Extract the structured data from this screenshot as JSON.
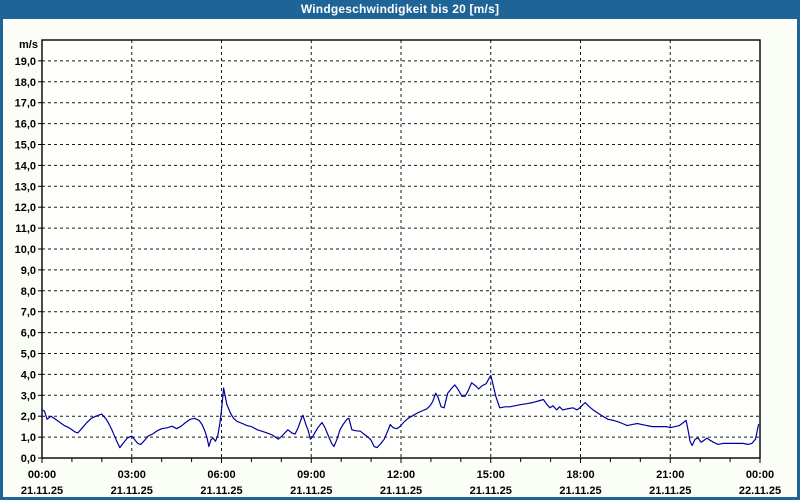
{
  "window": {
    "title": "Windgeschwindigkeit bis 20 [m/s]"
  },
  "colors": {
    "titlebar_bg": "#1e6496",
    "titlebar_text": "#ffffff",
    "frame": "#1e6496",
    "window_bg": "#fbfdf7",
    "plot_bg": "#fffffd",
    "grid": "#1a1a1a",
    "axis": "#000000",
    "label_text": "#000000",
    "series_line": "#0000a0"
  },
  "chart_data": {
    "type": "line",
    "title": "Windgeschwindigkeit bis 20 [m/s]",
    "unit_label": "m/s",
    "ylim": [
      0,
      20
    ],
    "ytick_labels": [
      "0,0",
      "1,0",
      "2,0",
      "3,0",
      "4,0",
      "5,0",
      "6,0",
      "7,0",
      "8,0",
      "9,0",
      "10,0",
      "11,0",
      "12,0",
      "13,0",
      "14,0",
      "15,0",
      "16,0",
      "17,0",
      "18,0",
      "19,0"
    ],
    "x_hours": [
      0,
      24
    ],
    "minor_xtick_every_hours": 1,
    "grid": "dashed",
    "legend": "none",
    "xticks": [
      {
        "hour": 0,
        "time": "00:00",
        "date": "21.11.25"
      },
      {
        "hour": 3,
        "time": "03:00",
        "date": "21.11.25"
      },
      {
        "hour": 6,
        "time": "06:00",
        "date": "21.11.25"
      },
      {
        "hour": 9,
        "time": "09:00",
        "date": "21.11.25"
      },
      {
        "hour": 12,
        "time": "12:00",
        "date": "21.11.25"
      },
      {
        "hour": 15,
        "time": "15:00",
        "date": "21.11.25"
      },
      {
        "hour": 18,
        "time": "18:00",
        "date": "21.11.25"
      },
      {
        "hour": 21,
        "time": "21:00",
        "date": "21.11.25"
      },
      {
        "hour": 24,
        "time": "00:00",
        "date": "22.11.25"
      }
    ],
    "series": [
      {
        "name": "Windgeschwindigkeit",
        "color": "#0000a0",
        "points": [
          [
            0,
            2.3
          ],
          [
            0.08,
            2.25
          ],
          [
            0.17,
            1.85
          ],
          [
            0.3,
            2.0
          ],
          [
            0.45,
            1.85
          ],
          [
            0.6,
            1.7
          ],
          [
            0.75,
            1.55
          ],
          [
            0.9,
            1.45
          ],
          [
            1.0,
            1.35
          ],
          [
            1.1,
            1.25
          ],
          [
            1.2,
            1.2
          ],
          [
            1.35,
            1.45
          ],
          [
            1.5,
            1.7
          ],
          [
            1.65,
            1.9
          ],
          [
            1.8,
            2.0
          ],
          [
            2.0,
            2.1
          ],
          [
            2.15,
            1.85
          ],
          [
            2.25,
            1.6
          ],
          [
            2.35,
            1.3
          ],
          [
            2.5,
            0.8
          ],
          [
            2.6,
            0.5
          ],
          [
            2.72,
            0.72
          ],
          [
            2.85,
            0.95
          ],
          [
            3.0,
            1.05
          ],
          [
            3.1,
            0.88
          ],
          [
            3.2,
            0.7
          ],
          [
            3.3,
            0.65
          ],
          [
            3.4,
            0.8
          ],
          [
            3.55,
            1.05
          ],
          [
            3.7,
            1.15
          ],
          [
            3.85,
            1.3
          ],
          [
            4.0,
            1.4
          ],
          [
            4.2,
            1.45
          ],
          [
            4.35,
            1.52
          ],
          [
            4.5,
            1.4
          ],
          [
            4.65,
            1.52
          ],
          [
            4.8,
            1.7
          ],
          [
            4.95,
            1.85
          ],
          [
            5.1,
            1.9
          ],
          [
            5.25,
            1.8
          ],
          [
            5.35,
            1.6
          ],
          [
            5.45,
            1.28
          ],
          [
            5.52,
            0.95
          ],
          [
            5.58,
            0.55
          ],
          [
            5.65,
            0.88
          ],
          [
            5.72,
            0.95
          ],
          [
            5.8,
            0.8
          ],
          [
            5.88,
            1.1
          ],
          [
            5.95,
            1.7
          ],
          [
            6.0,
            2.3
          ],
          [
            6.07,
            3.35
          ],
          [
            6.18,
            2.55
          ],
          [
            6.3,
            2.15
          ],
          [
            6.4,
            1.9
          ],
          [
            6.52,
            1.75
          ],
          [
            6.7,
            1.65
          ],
          [
            6.85,
            1.55
          ],
          [
            7.0,
            1.5
          ],
          [
            7.2,
            1.35
          ],
          [
            7.35,
            1.28
          ],
          [
            7.52,
            1.2
          ],
          [
            7.7,
            1.1
          ],
          [
            7.8,
            1.0
          ],
          [
            7.9,
            0.9
          ],
          [
            8.02,
            1.05
          ],
          [
            8.12,
            1.2
          ],
          [
            8.22,
            1.35
          ],
          [
            8.35,
            1.2
          ],
          [
            8.46,
            1.15
          ],
          [
            8.56,
            1.45
          ],
          [
            8.66,
            1.85
          ],
          [
            8.72,
            2.05
          ],
          [
            8.82,
            1.6
          ],
          [
            8.9,
            1.3
          ],
          [
            8.97,
            0.9
          ],
          [
            9.06,
            1.05
          ],
          [
            9.22,
            1.45
          ],
          [
            9.36,
            1.7
          ],
          [
            9.46,
            1.45
          ],
          [
            9.56,
            1.1
          ],
          [
            9.68,
            0.7
          ],
          [
            9.76,
            0.55
          ],
          [
            9.86,
            0.9
          ],
          [
            9.96,
            1.35
          ],
          [
            10.06,
            1.6
          ],
          [
            10.19,
            1.85
          ],
          [
            10.26,
            1.9
          ],
          [
            10.36,
            1.35
          ],
          [
            10.5,
            1.3
          ],
          [
            10.64,
            1.28
          ],
          [
            10.8,
            1.1
          ],
          [
            10.9,
            1.0
          ],
          [
            11.0,
            0.85
          ],
          [
            11.1,
            0.55
          ],
          [
            11.2,
            0.5
          ],
          [
            11.3,
            0.65
          ],
          [
            11.44,
            0.9
          ],
          [
            11.56,
            1.3
          ],
          [
            11.64,
            1.6
          ],
          [
            11.74,
            1.45
          ],
          [
            11.86,
            1.4
          ],
          [
            11.96,
            1.5
          ],
          [
            12.12,
            1.75
          ],
          [
            12.24,
            1.9
          ],
          [
            12.36,
            2.0
          ],
          [
            12.54,
            2.15
          ],
          [
            12.7,
            2.25
          ],
          [
            12.86,
            2.35
          ],
          [
            12.97,
            2.5
          ],
          [
            13.06,
            2.7
          ],
          [
            13.16,
            3.1
          ],
          [
            13.24,
            2.9
          ],
          [
            13.34,
            2.45
          ],
          [
            13.44,
            2.4
          ],
          [
            13.56,
            3.1
          ],
          [
            13.7,
            3.35
          ],
          [
            13.8,
            3.5
          ],
          [
            13.9,
            3.3
          ],
          [
            14.04,
            2.95
          ],
          [
            14.14,
            2.95
          ],
          [
            14.24,
            3.2
          ],
          [
            14.36,
            3.6
          ],
          [
            14.5,
            3.45
          ],
          [
            14.6,
            3.3
          ],
          [
            14.7,
            3.45
          ],
          [
            14.84,
            3.55
          ],
          [
            14.92,
            3.75
          ],
          [
            15.0,
            3.95
          ],
          [
            15.08,
            3.5
          ],
          [
            15.17,
            2.95
          ],
          [
            15.3,
            2.4
          ],
          [
            15.48,
            2.45
          ],
          [
            15.64,
            2.45
          ],
          [
            15.8,
            2.5
          ],
          [
            15.98,
            2.55
          ],
          [
            16.2,
            2.6
          ],
          [
            16.4,
            2.65
          ],
          [
            16.65,
            2.75
          ],
          [
            16.76,
            2.8
          ],
          [
            16.88,
            2.55
          ],
          [
            16.98,
            2.4
          ],
          [
            17.08,
            2.5
          ],
          [
            17.2,
            2.3
          ],
          [
            17.3,
            2.45
          ],
          [
            17.4,
            2.3
          ],
          [
            17.55,
            2.35
          ],
          [
            17.75,
            2.4
          ],
          [
            17.88,
            2.3
          ],
          [
            17.98,
            2.4
          ],
          [
            18.08,
            2.55
          ],
          [
            18.16,
            2.65
          ],
          [
            18.26,
            2.5
          ],
          [
            18.42,
            2.3
          ],
          [
            18.58,
            2.15
          ],
          [
            18.75,
            2.0
          ],
          [
            18.92,
            1.85
          ],
          [
            19.1,
            1.8
          ],
          [
            19.22,
            1.75
          ],
          [
            19.4,
            1.65
          ],
          [
            19.56,
            1.55
          ],
          [
            19.72,
            1.6
          ],
          [
            19.9,
            1.65
          ],
          [
            20.06,
            1.6
          ],
          [
            20.22,
            1.55
          ],
          [
            20.4,
            1.5
          ],
          [
            20.56,
            1.5
          ],
          [
            20.73,
            1.5
          ],
          [
            20.86,
            1.5
          ],
          [
            21.0,
            1.45
          ],
          [
            21.16,
            1.5
          ],
          [
            21.3,
            1.55
          ],
          [
            21.44,
            1.7
          ],
          [
            21.53,
            1.8
          ],
          [
            21.6,
            1.3
          ],
          [
            21.66,
            0.8
          ],
          [
            21.73,
            0.6
          ],
          [
            21.83,
            0.9
          ],
          [
            21.93,
            0.95
          ],
          [
            22.03,
            0.75
          ],
          [
            22.13,
            0.85
          ],
          [
            22.23,
            0.95
          ],
          [
            22.33,
            0.85
          ],
          [
            22.45,
            0.75
          ],
          [
            22.6,
            0.65
          ],
          [
            22.76,
            0.7
          ],
          [
            22.93,
            0.7
          ],
          [
            23.1,
            0.7
          ],
          [
            23.26,
            0.7
          ],
          [
            23.43,
            0.7
          ],
          [
            23.6,
            0.65
          ],
          [
            23.73,
            0.7
          ],
          [
            23.85,
            0.9
          ],
          [
            23.95,
            1.6
          ]
        ]
      }
    ]
  }
}
